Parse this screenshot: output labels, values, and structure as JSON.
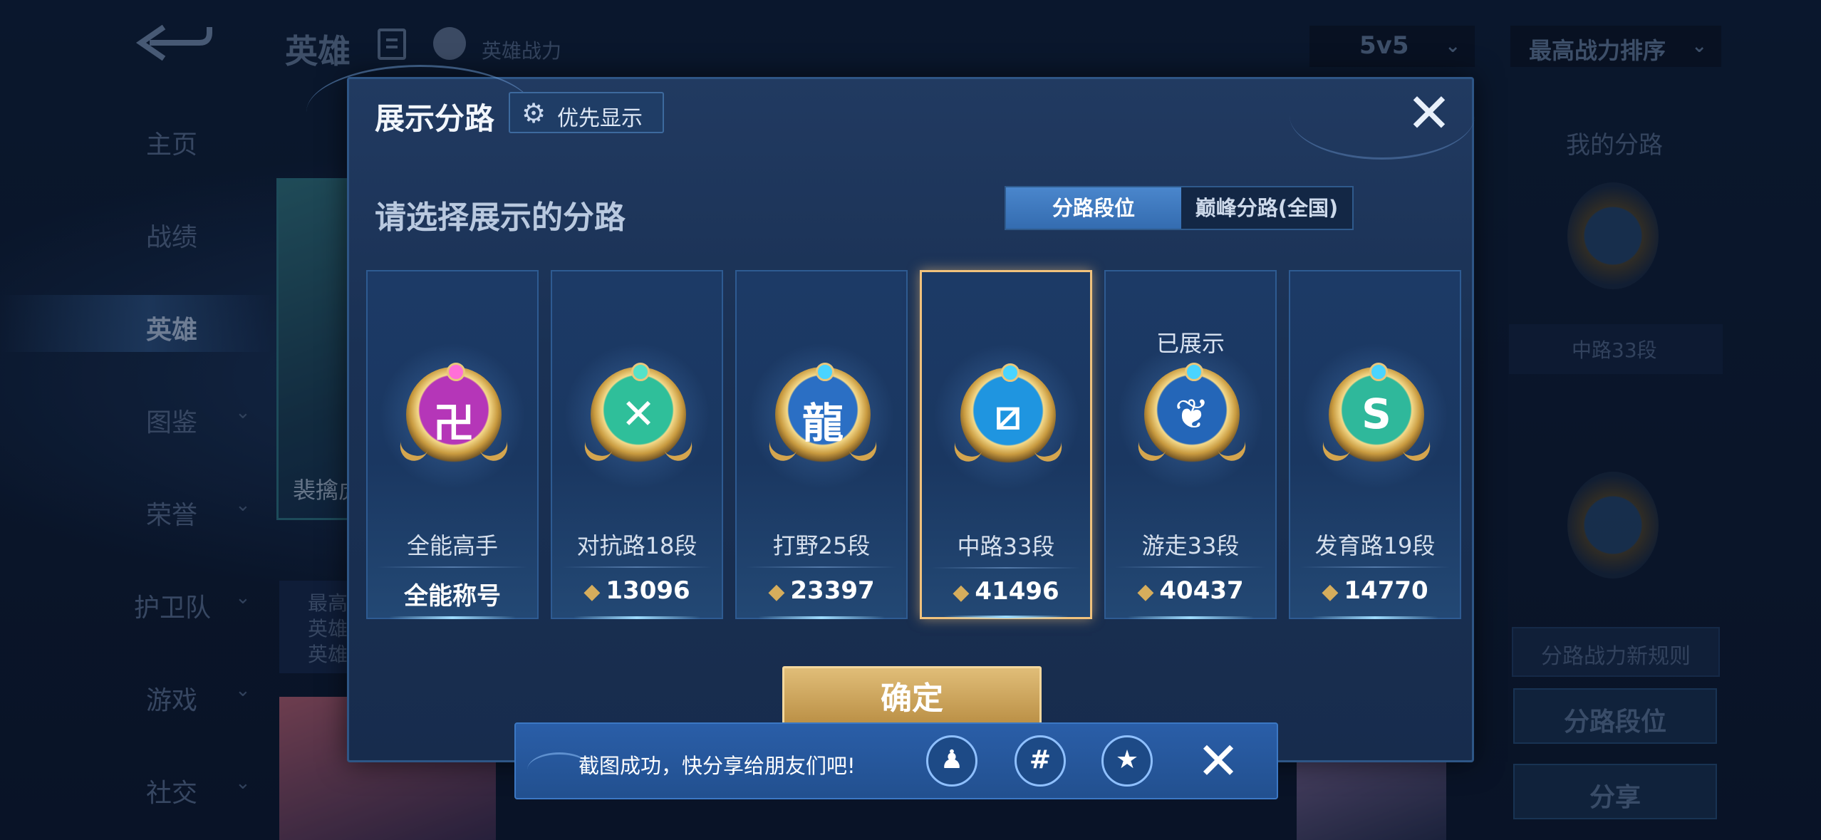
{
  "header": {
    "title": "英雄",
    "subtitle": "英雄战力",
    "mode_select": "5v5",
    "sort_select": "最高战力排序"
  },
  "nav": {
    "items": [
      {
        "label": "主页",
        "has_chevron": false
      },
      {
        "label": "战绩",
        "has_chevron": false
      },
      {
        "label": "英雄",
        "has_chevron": false,
        "active": true
      },
      {
        "label": "图鉴",
        "has_chevron": true
      },
      {
        "label": "荣誉",
        "has_chevron": true
      },
      {
        "label": "护卫队",
        "has_chevron": true
      },
      {
        "label": "游戏",
        "has_chevron": true
      },
      {
        "label": "社交",
        "has_chevron": true
      }
    ]
  },
  "hero_card": {
    "name": "裴擒虎",
    "info_lines": [
      "最高",
      "英雄",
      "英雄"
    ]
  },
  "right_panel": {
    "title": "我的分路",
    "current_lane": "中路33段",
    "rules_button": "分路战力新规则",
    "lane_rank_button": "分路段位",
    "share_button": "分享"
  },
  "modal": {
    "title": "展示分路",
    "priority_button": "优先显示",
    "prompt": "请选择展示的分路",
    "tabs": [
      "分路段位",
      "巅峰分路(全国)"
    ],
    "active_tab": 0,
    "cards": [
      {
        "lane": "全能高手",
        "score": "全能称号",
        "has_power_icon": false,
        "status": "",
        "selected": false,
        "badge_color": "#b536b8",
        "pin_color": "#ff6fd8",
        "glyph": "卍",
        "icon": "all-round-badge-icon"
      },
      {
        "lane": "对抗路18段",
        "score": "13096",
        "has_power_icon": true,
        "status": "",
        "selected": false,
        "badge_color": "#2fbf9a",
        "pin_color": "#55e2c8",
        "glyph": "✕",
        "icon": "clash-lane-badge-icon"
      },
      {
        "lane": "打野25段",
        "score": "23397",
        "has_power_icon": true,
        "status": "",
        "selected": false,
        "badge_color": "#2b6fc4",
        "pin_color": "#4ad4ff",
        "glyph": "龍",
        "icon": "jungle-badge-icon"
      },
      {
        "lane": "中路33段",
        "score": "41496",
        "has_power_icon": true,
        "status": "",
        "selected": true,
        "badge_color": "#1f95e0",
        "pin_color": "#4ad4ff",
        "glyph": "⧄",
        "icon": "mid-lane-badge-icon"
      },
      {
        "lane": "游走33段",
        "score": "40437",
        "has_power_icon": true,
        "status": "已展示",
        "selected": false,
        "badge_color": "#2466b8",
        "pin_color": "#4ad4ff",
        "glyph": "❦",
        "icon": "roam-badge-icon"
      },
      {
        "lane": "发育路19段",
        "score": "14770",
        "has_power_icon": true,
        "status": "",
        "selected": false,
        "badge_color": "#2fb89b",
        "pin_color": "#4ad4ff",
        "glyph": "S",
        "icon": "farm-lane-badge-icon"
      }
    ],
    "confirm_button": "确定"
  },
  "toast": {
    "message": "截图成功，快分享给朋友们吧!",
    "share_targets": [
      {
        "name": "qq-share-button",
        "glyph": "♟"
      },
      {
        "name": "moments-share-button",
        "glyph": "#"
      },
      {
        "name": "qzone-share-button",
        "glyph": "★"
      }
    ]
  }
}
